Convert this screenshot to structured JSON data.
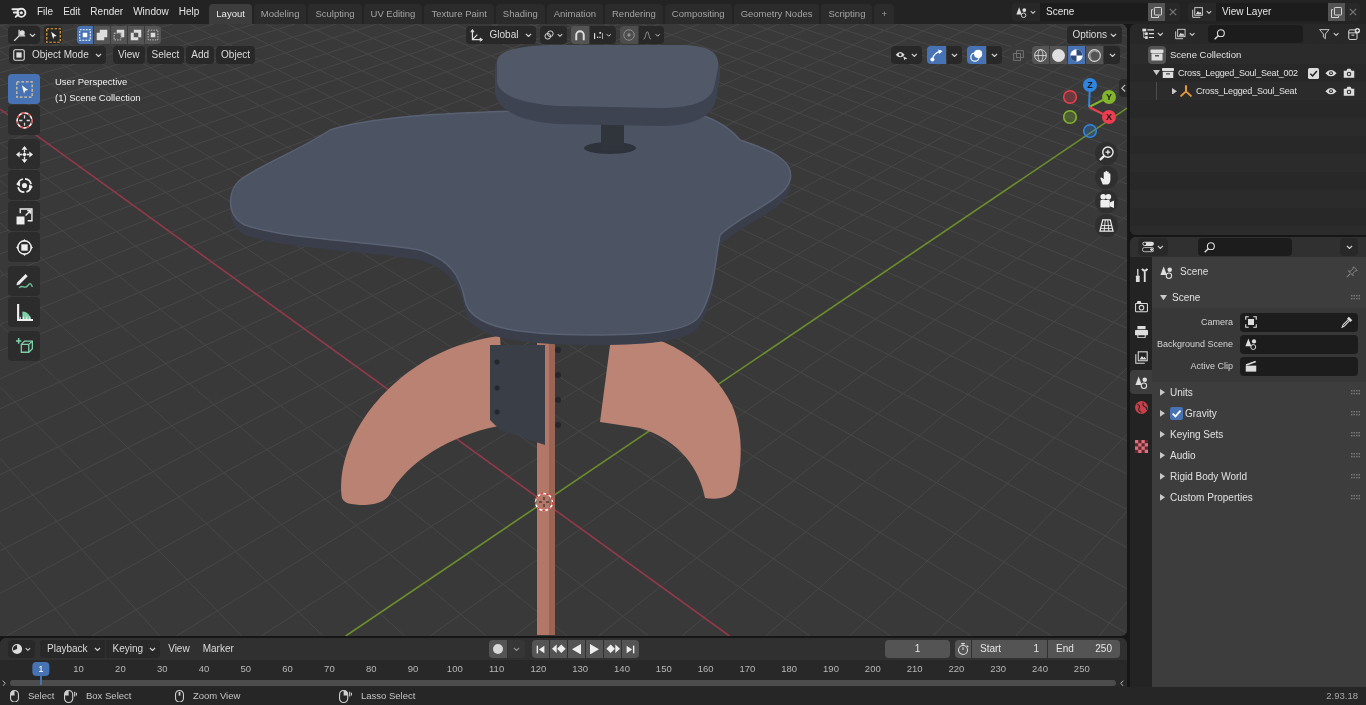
{
  "top_bar": {
    "menus": [
      "File",
      "Edit",
      "Render",
      "Window",
      "Help"
    ],
    "workspaces": [
      {
        "label": "Layout",
        "selected": true
      },
      {
        "label": "Modeling",
        "selected": false
      },
      {
        "label": "Sculpting",
        "selected": false
      },
      {
        "label": "UV Editing",
        "selected": false
      },
      {
        "label": "Texture Paint",
        "selected": false
      },
      {
        "label": "Shading",
        "selected": false
      },
      {
        "label": "Animation",
        "selected": false
      },
      {
        "label": "Rendering",
        "selected": false
      },
      {
        "label": "Compositing",
        "selected": false
      },
      {
        "label": "Geometry Nodes",
        "selected": false
      },
      {
        "label": "Scripting",
        "selected": false
      }
    ],
    "add_workspace": "+",
    "scene": "Scene",
    "view_layer": "View Layer"
  },
  "viewport": {
    "select_modes": [
      {
        "kind": "set",
        "selected": true
      },
      {
        "kind": "extend",
        "selected": false
      },
      {
        "kind": "subtract",
        "selected": false
      },
      {
        "kind": "invert",
        "selected": false
      },
      {
        "kind": "intersect",
        "selected": false
      }
    ],
    "orientation": "Global",
    "snap_on": false,
    "proportional_on": false,
    "options": "Options",
    "mode": "Object Mode",
    "menus": [
      "View",
      "Select",
      "Add",
      "Object"
    ],
    "gizmos_on": true,
    "overlays_on": true,
    "xray_on": false,
    "shading": [
      {
        "kind": "wireframe",
        "selected": false
      },
      {
        "kind": "solid",
        "selected": false
      },
      {
        "kind": "material",
        "selected": true
      },
      {
        "kind": "rendered",
        "selected": false
      }
    ],
    "tool_groups": [
      [
        {
          "kind": "select",
          "selected": true
        },
        {
          "kind": "cursor",
          "selected": false
        }
      ],
      [
        {
          "kind": "move",
          "selected": false
        },
        {
          "kind": "rotate",
          "selected": false
        },
        {
          "kind": "scale",
          "selected": false
        },
        {
          "kind": "transform",
          "selected": false
        }
      ],
      [
        {
          "kind": "annotate",
          "selected": false
        },
        {
          "kind": "measure",
          "selected": false
        }
      ],
      [
        {
          "kind": "addcube",
          "selected": false
        }
      ]
    ],
    "overlay_text": [
      "User Perspective",
      "(1) Scene Collection"
    ],
    "axes": [
      {
        "label": "Z",
        "color": "#2f86e2"
      },
      {
        "label": "Y",
        "color": "#82b42c"
      },
      {
        "label": "X",
        "color": "#ec3e4f"
      }
    ]
  },
  "outliner": {
    "tree": [
      {
        "label": "Scene Collection",
        "kind": "root",
        "children": [
          {
            "label": "Cross_Legged_Soul_Seat_002",
            "kind": "collection",
            "expanded": true,
            "checked": true,
            "children": [
              {
                "label": "Cross_Legged_Soul_Seat",
                "kind": "empty",
                "expanded": false
              }
            ]
          }
        ]
      }
    ]
  },
  "properties": {
    "tab_groups": [
      [
        {
          "kind": "tool",
          "selected": false
        }
      ],
      [
        {
          "kind": "render",
          "selected": false
        },
        {
          "kind": "output",
          "selected": false
        },
        {
          "kind": "viewlayer",
          "selected": false
        },
        {
          "kind": "scene",
          "selected": true
        },
        {
          "kind": "world",
          "selected": false
        }
      ],
      [
        {
          "kind": "texture",
          "selected": false
        }
      ]
    ],
    "context": "Scene",
    "panels": [
      {
        "title": "Scene",
        "expanded": true,
        "fields": [
          {
            "label": "Camera",
            "kind": "camera"
          },
          {
            "label": "Background Scene",
            "kind": "scene"
          },
          {
            "label": "Active Clip",
            "kind": "clip"
          }
        ]
      },
      {
        "title": "Units",
        "expanded": false
      },
      {
        "title": "Gravity",
        "expanded": false,
        "checked": true
      },
      {
        "title": "Keying Sets",
        "expanded": false
      },
      {
        "title": "Audio",
        "expanded": false
      },
      {
        "title": "Rigid Body World",
        "expanded": false
      },
      {
        "title": "Custom Properties",
        "expanded": false
      }
    ]
  },
  "timeline": {
    "menus": [
      {
        "label": "Playback",
        "kind": "dropdown"
      },
      {
        "label": "Keying",
        "kind": "dropdown"
      },
      {
        "label": "View",
        "kind": "menu"
      },
      {
        "label": "Marker",
        "kind": "menu"
      }
    ],
    "record_on": false,
    "current_frame": "1",
    "start": {
      "label": "Start",
      "value": "1"
    },
    "end": {
      "label": "End",
      "value": "250"
    },
    "frames": [
      {
        "label": "1",
        "selected": true
      },
      {
        "label": "10",
        "selected": false
      },
      {
        "label": "20",
        "selected": false
      },
      {
        "label": "30",
        "selected": false
      },
      {
        "label": "40",
        "selected": false
      },
      {
        "label": "50",
        "selected": false
      },
      {
        "label": "60",
        "selected": false
      },
      {
        "label": "70",
        "selected": false
      },
      {
        "label": "80",
        "selected": false
      },
      {
        "label": "90",
        "selected": false
      },
      {
        "label": "100",
        "selected": false
      },
      {
        "label": "110",
        "selected": false
      },
      {
        "label": "120",
        "selected": false
      },
      {
        "label": "130",
        "selected": false
      },
      {
        "label": "140",
        "selected": false
      },
      {
        "label": "150",
        "selected": false
      },
      {
        "label": "160",
        "selected": false
      },
      {
        "label": "170",
        "selected": false
      },
      {
        "label": "180",
        "selected": false
      },
      {
        "label": "190",
        "selected": false
      },
      {
        "label": "200",
        "selected": false
      },
      {
        "label": "210",
        "selected": false
      },
      {
        "label": "220",
        "selected": false
      },
      {
        "label": "230",
        "selected": false
      },
      {
        "label": "240",
        "selected": false
      },
      {
        "label": "250",
        "selected": false
      }
    ]
  },
  "status_bar": {
    "hints": [
      {
        "label": "Select",
        "kind": "left"
      },
      {
        "label": "Box Select",
        "kind": "drag"
      },
      {
        "label": "Zoom View",
        "kind": "middle"
      },
      {
        "label": "Lasso Select",
        "kind": "rightdrag"
      }
    ],
    "version": "2.93.18"
  }
}
